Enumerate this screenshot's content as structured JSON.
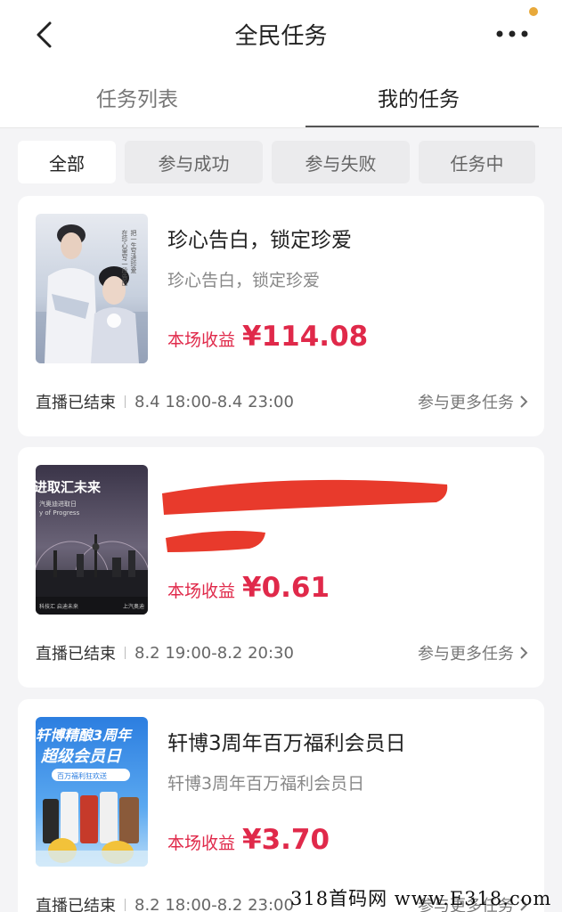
{
  "header": {
    "title": "全民任务",
    "back_icon": "chevron-left-icon",
    "more_icon": "more-dots-icon",
    "notif_color": "#e8a93a"
  },
  "tabs": [
    {
      "label": "任务列表",
      "active": false
    },
    {
      "label": "我的任务",
      "active": true
    }
  ],
  "filters": [
    {
      "label": "全部",
      "active": true
    },
    {
      "label": "参与成功",
      "active": false
    },
    {
      "label": "参与失败",
      "active": false
    },
    {
      "label": "任务中",
      "active": false
    }
  ],
  "tasks": [
    {
      "title": "珍心告白，锁定珍爱",
      "subtitle": "珍心告白，锁定珍爱",
      "earnings_label": "本场收益",
      "earnings": "¥114.08",
      "status": "直播已结束",
      "time": "8.4 18:00-8.4 23:00",
      "more": "参与更多任务",
      "thumb": {
        "vertical_text_1": "在珍心里写一段告白",
        "vertical_text_2": "把一生写进珍爱"
      }
    },
    {
      "title": "",
      "subtitle": "",
      "earnings_label": "本场收益",
      "earnings": "¥0.61",
      "status": "直播已结束",
      "time": "8.2 19:00-8.2 20:30",
      "more": "参与更多任务",
      "thumb": {
        "headline": "进取汇未来",
        "sub1": "汽奥迪进取日",
        "sub2": "y of Progress",
        "bottom_left": "科技汇 启迪未来",
        "bottom_right": "上汽奥迪"
      },
      "redacted": true
    },
    {
      "title": "轩博3周年百万福利会员日",
      "subtitle": "轩博3周年百万福利会员日",
      "earnings_label": "本场收益",
      "earnings": "¥3.70",
      "status": "直播已结束",
      "time": "8.2 18:00-8.2 23:00",
      "more": "参与更多任务",
      "thumb": {
        "line1": "轩博精酿3周年",
        "line2": "超级会员日",
        "ribbon": "百万福利狂欢送"
      }
    }
  ],
  "colors": {
    "accent": "#e0294a",
    "page_bg": "#f4f4f6",
    "redaction": "#e83a2c"
  },
  "watermark": "318首码网 www.E318.com"
}
